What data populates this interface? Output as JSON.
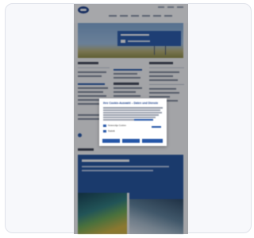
{
  "consent_dialog": {
    "title": "Ihre Cookie-Auswahl – Daten und Dienste",
    "options": [
      {
        "label": "Notwendige Cookies"
      },
      {
        "label": "Statistik"
      }
    ]
  },
  "colors": {
    "brand": "#1b3f8a",
    "accent": "#2456a8",
    "overlay": "rgba(20,24,32,0.38)"
  }
}
